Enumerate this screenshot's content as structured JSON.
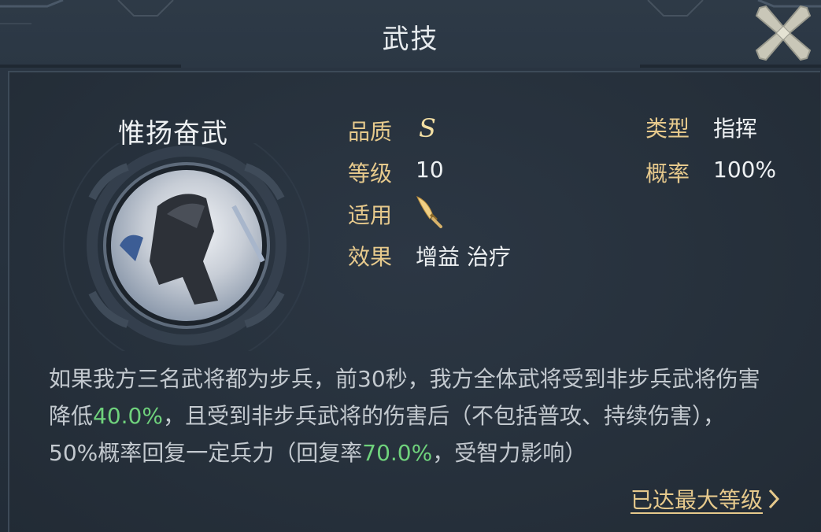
{
  "header": {
    "title": "武技"
  },
  "skill": {
    "name": "惟扬奋武",
    "quality_label": "品质",
    "quality_value": "S",
    "level_label": "等级",
    "level_value": "10",
    "applies_label": "适用",
    "applies_icon": "saber-icon",
    "effect_label": "效果",
    "effect_value": "增益 治疗",
    "type_label": "类型",
    "type_value": "指挥",
    "rate_label": "概率",
    "rate_value": "100%"
  },
  "description": {
    "part1": "如果我方三名武将都为步兵，前30秒，我方全体武将受到非步兵武将伤害降低",
    "value1": "40.0%",
    "part2": "，且受到非步兵武将的伤害后（不包括普攻、持续伤害），50%概率回复一定兵力（回复率",
    "value2": "70.0%",
    "part3": "，受智力影响）"
  },
  "footer": {
    "max_level_label": "已达最大等级"
  },
  "colors": {
    "gold_label": "#e6c98c",
    "highlight_green": "#6fd27c",
    "panel_bg": "#27323e"
  }
}
